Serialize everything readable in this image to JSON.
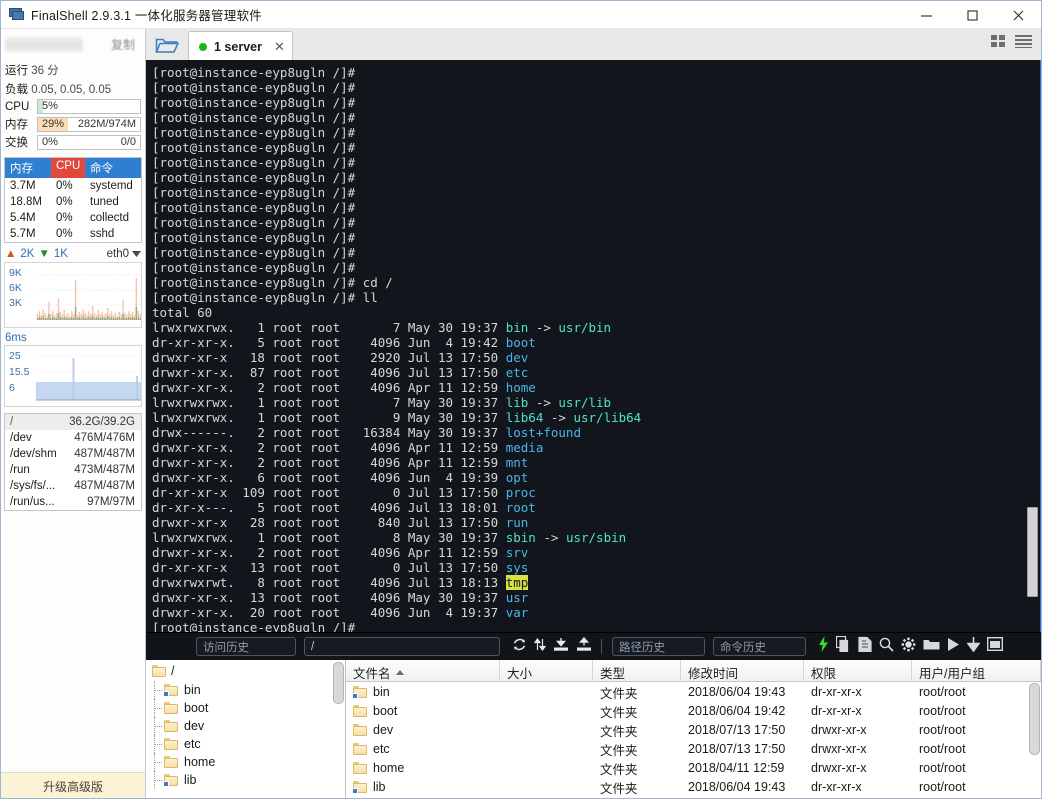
{
  "window": {
    "title": "FinalShell 2.9.3.1 一体化服务器管理软件",
    "minimize": "—",
    "maximize": "□",
    "close": "✕"
  },
  "header": {
    "copy_label": "复制",
    "tab": {
      "label": "1 server",
      "close": "✕",
      "status_color": "#16b816"
    }
  },
  "sidebar": {
    "uptime": {
      "label": "运行",
      "value": "36 分"
    },
    "load": {
      "label": "负载",
      "value": "0.05, 0.05, 0.05"
    },
    "cpu": {
      "label": "CPU",
      "percent": "5%",
      "fill_pct": 5,
      "fill_color": "#c9ecd4"
    },
    "memory": {
      "label": "内存",
      "percent": "29%",
      "detail": "282M/974M",
      "fill_pct": 29,
      "fill_color": "#fbdcb4"
    },
    "swap": {
      "label": "交换",
      "percent": "0%",
      "detail": "0/0",
      "fill_pct": 0,
      "fill_color": "#dddddd"
    },
    "process_table": {
      "headers": {
        "mem": "内存",
        "cpu": "CPU",
        "cmd": "命令"
      },
      "rows": [
        {
          "mem": "3.7M",
          "cpu": "0%",
          "cmd": "systemd"
        },
        {
          "mem": "18.8M",
          "cpu": "0%",
          "cmd": "tuned"
        },
        {
          "mem": "5.4M",
          "cpu": "0%",
          "cmd": "collectd"
        },
        {
          "mem": "5.7M",
          "cpu": "0%",
          "cmd": "sshd"
        }
      ]
    },
    "network": {
      "upload": "2K",
      "download": "1K",
      "interface": "eth0",
      "y_ticks": [
        "9K",
        "6K",
        "3K"
      ]
    },
    "latency": {
      "label": "6ms",
      "y_ticks": [
        "25",
        "15.5",
        "6"
      ]
    },
    "disks": [
      {
        "mount": "/",
        "usage": "36.2G/39.2G",
        "selected": true
      },
      {
        "mount": "/dev",
        "usage": "476M/476M",
        "selected": false
      },
      {
        "mount": "/dev/shm",
        "usage": "487M/487M",
        "selected": false
      },
      {
        "mount": "/run",
        "usage": "473M/487M",
        "selected": false
      },
      {
        "mount": "/sys/fs/...",
        "usage": "487M/487M",
        "selected": false
      },
      {
        "mount": "/run/us...",
        "usage": "97M/97M",
        "selected": false
      }
    ],
    "upgrade_label": "升级高级版"
  },
  "terminal": {
    "prompt": "[root@instance-eyp8ugln /]#",
    "blank_prompt_count": 14,
    "commands": [
      {
        "prompt": "[root@instance-eyp8ugln /]#",
        "cmd": " cd /"
      },
      {
        "prompt": "[root@instance-eyp8ugln /]#",
        "cmd": " ll"
      }
    ],
    "total_line": "total 60",
    "listing": [
      {
        "perm": "lrwxrwxrwx.",
        "links": "  1",
        "owner": "root root",
        "size": "      7",
        "date": "May 30 19:37",
        "name": "bin",
        "type": "link",
        "target": "usr/bin"
      },
      {
        "perm": "dr-xr-xr-x.",
        "links": "  5",
        "owner": "root root",
        "size": "   4096",
        "date": "Jun  4 19:42",
        "name": "boot",
        "type": "dir"
      },
      {
        "perm": "drwxr-xr-x ",
        "links": " 18",
        "owner": "root root",
        "size": "   2920",
        "date": "Jul 13 17:50",
        "name": "dev",
        "type": "dir"
      },
      {
        "perm": "drwxr-xr-x.",
        "links": " 87",
        "owner": "root root",
        "size": "   4096",
        "date": "Jul 13 17:50",
        "name": "etc",
        "type": "dir"
      },
      {
        "perm": "drwxr-xr-x.",
        "links": "  2",
        "owner": "root root",
        "size": "   4096",
        "date": "Apr 11 12:59",
        "name": "home",
        "type": "dir"
      },
      {
        "perm": "lrwxrwxrwx.",
        "links": "  1",
        "owner": "root root",
        "size": "      7",
        "date": "May 30 19:37",
        "name": "lib",
        "type": "link",
        "target": "usr/lib"
      },
      {
        "perm": "lrwxrwxrwx.",
        "links": "  1",
        "owner": "root root",
        "size": "      9",
        "date": "May 30 19:37",
        "name": "lib64",
        "type": "link",
        "target": "usr/lib64"
      },
      {
        "perm": "drwx------.",
        "links": "  2",
        "owner": "root root",
        "size": "  16384",
        "date": "May 30 19:37",
        "name": "lost+found",
        "type": "dir"
      },
      {
        "perm": "drwxr-xr-x.",
        "links": "  2",
        "owner": "root root",
        "size": "   4096",
        "date": "Apr 11 12:59",
        "name": "media",
        "type": "dir"
      },
      {
        "perm": "drwxr-xr-x.",
        "links": "  2",
        "owner": "root root",
        "size": "   4096",
        "date": "Apr 11 12:59",
        "name": "mnt",
        "type": "dir"
      },
      {
        "perm": "drwxr-xr-x.",
        "links": "  6",
        "owner": "root root",
        "size": "   4096",
        "date": "Jun  4 19:39",
        "name": "opt",
        "type": "dir"
      },
      {
        "perm": "dr-xr-xr-x ",
        "links": "109",
        "owner": "root root",
        "size": "      0",
        "date": "Jul 13 17:50",
        "name": "proc",
        "type": "dir"
      },
      {
        "perm": "dr-xr-x---.",
        "links": "  5",
        "owner": "root root",
        "size": "   4096",
        "date": "Jul 13 18:01",
        "name": "root",
        "type": "dir"
      },
      {
        "perm": "drwxr-xr-x ",
        "links": " 28",
        "owner": "root root",
        "size": "    840",
        "date": "Jul 13 17:50",
        "name": "run",
        "type": "dir"
      },
      {
        "perm": "lrwxrwxrwx.",
        "links": "  1",
        "owner": "root root",
        "size": "      8",
        "date": "May 30 19:37",
        "name": "sbin",
        "type": "link",
        "target": "usr/sbin"
      },
      {
        "perm": "drwxr-xr-x.",
        "links": "  2",
        "owner": "root root",
        "size": "   4096",
        "date": "Apr 11 12:59",
        "name": "srv",
        "type": "dir"
      },
      {
        "perm": "dr-xr-xr-x ",
        "links": " 13",
        "owner": "root root",
        "size": "      0",
        "date": "Jul 13 17:50",
        "name": "sys",
        "type": "dir"
      },
      {
        "perm": "drwxrwxrwt.",
        "links": "  8",
        "owner": "root root",
        "size": "   4096",
        "date": "Jul 13 18:13",
        "name": "tmp",
        "type": "highlight"
      },
      {
        "perm": "drwxr-xr-x.",
        "links": " 13",
        "owner": "root root",
        "size": "   4096",
        "date": "May 30 19:37",
        "name": "usr",
        "type": "dir"
      },
      {
        "perm": "drwxr-xr-x.",
        "links": " 20",
        "owner": "root root",
        "size": "   4096",
        "date": "Jun  4 19:37",
        "name": "var",
        "type": "dir"
      }
    ],
    "final_prompt": "[root@instance-eyp8ugln /]#"
  },
  "toolbar": {
    "visit_history": "访问历史",
    "path_value": "/",
    "path_history": "路径历史",
    "command_history": "命令历史"
  },
  "filetree": {
    "root": "/",
    "items": [
      {
        "label": "bin",
        "link": true
      },
      {
        "label": "boot",
        "link": false
      },
      {
        "label": "dev",
        "link": false
      },
      {
        "label": "etc",
        "link": false
      },
      {
        "label": "home",
        "link": false
      },
      {
        "label": "lib",
        "link": true
      }
    ]
  },
  "filelist": {
    "columns": {
      "name": "文件名",
      "size": "大小",
      "type": "类型",
      "time": "修改时间",
      "perm": "权限",
      "owner": "用户/用户组"
    },
    "rows": [
      {
        "name": "bin",
        "size": "",
        "type": "文件夹",
        "time": "2018/06/04 19:43",
        "perm": "dr-xr-xr-x",
        "owner": "root/root",
        "link": true
      },
      {
        "name": "boot",
        "size": "",
        "type": "文件夹",
        "time": "2018/06/04 19:42",
        "perm": "dr-xr-xr-x",
        "owner": "root/root",
        "link": false
      },
      {
        "name": "dev",
        "size": "",
        "type": "文件夹",
        "time": "2018/07/13 17:50",
        "perm": "drwxr-xr-x",
        "owner": "root/root",
        "link": false
      },
      {
        "name": "etc",
        "size": "",
        "type": "文件夹",
        "time": "2018/07/13 17:50",
        "perm": "drwxr-xr-x",
        "owner": "root/root",
        "link": false
      },
      {
        "name": "home",
        "size": "",
        "type": "文件夹",
        "time": "2018/04/11 12:59",
        "perm": "drwxr-xr-x",
        "owner": "root/root",
        "link": false
      },
      {
        "name": "lib",
        "size": "",
        "type": "文件夹",
        "time": "2018/06/04 19:43",
        "perm": "dr-xr-xr-x",
        "owner": "root/root",
        "link": true
      }
    ]
  }
}
